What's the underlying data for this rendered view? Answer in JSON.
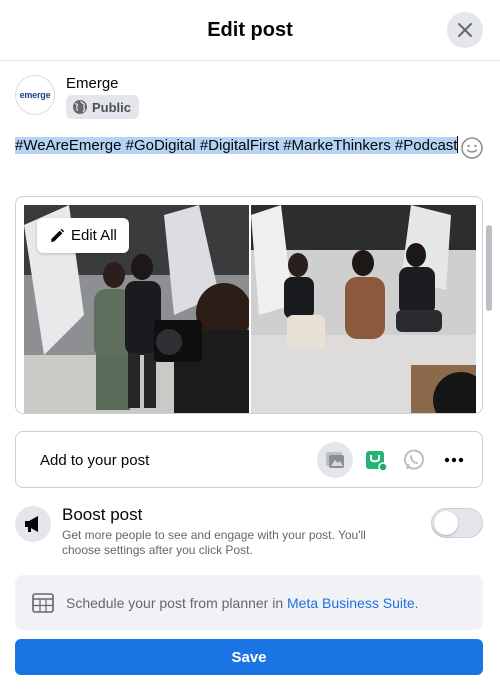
{
  "dialog": {
    "title": "Edit post"
  },
  "author": {
    "name": "Emerge",
    "avatar_text": "emerge",
    "privacy_label": "Public"
  },
  "post": {
    "hashtags": [
      "#WeAreEmerge",
      "#GoDigital",
      "#DigitalFirst",
      "#MarkeThinkers",
      "#Podcast"
    ]
  },
  "media": {
    "edit_all_label": "Edit All",
    "photo_count": 2
  },
  "add_to_post": {
    "label": "Add to your post",
    "icons": [
      "photo-video-icon",
      "shopping-tag-icon",
      "whatsapp-icon",
      "more-icon"
    ]
  },
  "boost": {
    "title": "Boost post",
    "description": "Get more people to see and engage with your post. You'll choose settings after you click Post.",
    "enabled": false
  },
  "schedule": {
    "text": "Schedule your post from planner in ",
    "link_text": "Meta Business Suite",
    "suffix": "."
  },
  "actions": {
    "save_label": "Save"
  },
  "colors": {
    "primary": "#1b74e4",
    "link": "#216fdb",
    "selection": "#b4d3f5",
    "green_tag": "#22b573"
  }
}
